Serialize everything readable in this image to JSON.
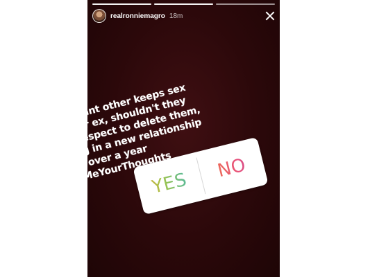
{
  "story": {
    "progress_segments": [
      {
        "state": "viewed"
      },
      {
        "state": "active"
      },
      {
        "state": "upcoming"
      }
    ],
    "header": {
      "username": "realronniemagro",
      "time": "18m",
      "close_icon": "close-icon"
    },
    "question_lines": [
      "If your significant other keeps sex",
      "videos of their ex, shouldn't they",
      "show enough respect to delete them,",
      "esp after being in a new relationship",
      "for over a year",
      "#GiveMeYourThoughts"
    ],
    "poll": {
      "yes_label": "YES",
      "no_label": "NO"
    },
    "colors": {
      "background": "#2b080a",
      "text": "#ffffff"
    }
  }
}
